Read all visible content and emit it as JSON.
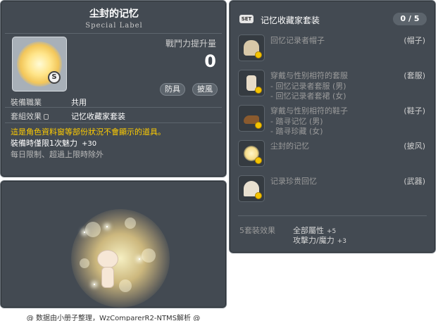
{
  "item_id": "01103491",
  "tooltip": {
    "title": "尘封的记忆",
    "subtitle": "Special Label",
    "boost_label": "戰鬥力提升量",
    "boost_value": "0",
    "tags": [
      "防具",
      "披風"
    ],
    "job_label": "裝備職業",
    "job_value": "共用",
    "set_effect_label": "套組效果",
    "set_effect_value": "记忆收藏家套装",
    "warning": "這是角色資料窗等部份狀況不會顯示的道具。",
    "limit_text": "裝備時僅限1次魅力",
    "limit_bonus": "+30",
    "limit_note": "每日限制、超過上限時除外"
  },
  "footer": "@ 数据由小册子整理，WzComparerR2-NTMS解析 @",
  "set_panel": {
    "badge": "SET",
    "name": "记忆收藏家套装",
    "count": "0 / 5",
    "items": [
      {
        "name": "回忆记录者帽子",
        "type": "(帽子)",
        "sub": [],
        "icon": "hat-icon",
        "color": "#d8c8a8"
      },
      {
        "name": "穿戴与性别相符的套服",
        "type": "(套服)",
        "sub": [
          "- 回忆记录者套服 (男)",
          "- 回忆记录者套裙 (女)"
        ],
        "icon": "outfit-icon",
        "color": "#e8dcc8"
      },
      {
        "name": "穿戴与性别相符的鞋子",
        "type": "(鞋子)",
        "sub": [
          "- 踏寻记忆 (男)",
          "- 踏寻珍藏 (女)"
        ],
        "icon": "shoes-icon",
        "color": "#8a5a2e"
      },
      {
        "name": "尘封的记忆",
        "type": "(披风)",
        "sub": [],
        "icon": "cape-icon",
        "color": "#f6dc8a"
      },
      {
        "name": "记录珍贵回忆",
        "type": "(武器)",
        "sub": [],
        "icon": "weapon-icon",
        "color": "#e8e0d0"
      }
    ],
    "effect_label": "5套裝效果",
    "effects": [
      {
        "stat": "全部屬性",
        "value": "+5"
      },
      {
        "stat": "攻擊力/魔力",
        "value": "+3"
      }
    ]
  }
}
